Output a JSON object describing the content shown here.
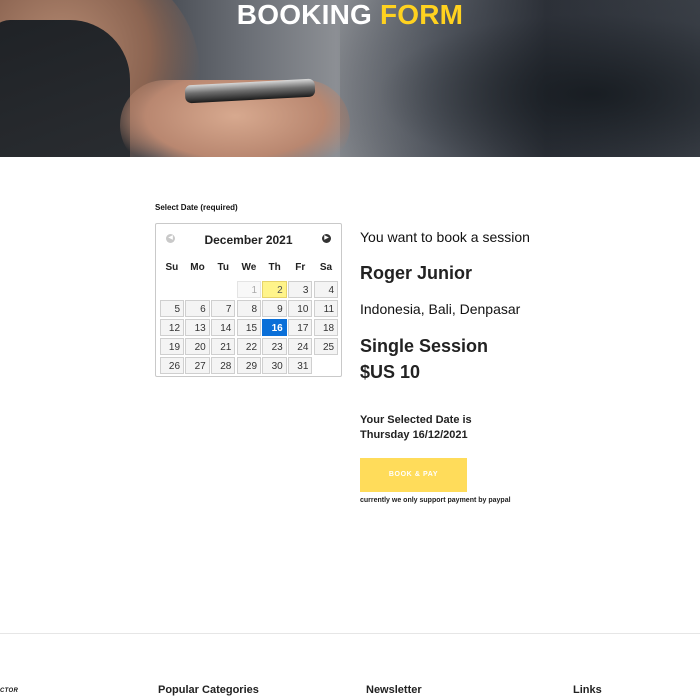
{
  "hero": {
    "title_part1": "BOOKING",
    "title_part2": "FORM",
    "accent_color": "#ffd21f"
  },
  "calendar": {
    "label": "Select Date (required)",
    "month_title": "December 2021",
    "prev_icon": "prev-arrow-icon",
    "next_icon": "next-arrow-icon",
    "weekdays": [
      "Su",
      "Mo",
      "Tu",
      "We",
      "Th",
      "Fr",
      "Sa"
    ],
    "weeks": [
      [
        "",
        "",
        "",
        "1",
        "2",
        "3",
        "4"
      ],
      [
        "5",
        "6",
        "7",
        "8",
        "9",
        "10",
        "11"
      ],
      [
        "12",
        "13",
        "14",
        "15",
        "16",
        "17",
        "18"
      ],
      [
        "19",
        "20",
        "21",
        "22",
        "23",
        "24",
        "25"
      ],
      [
        "26",
        "27",
        "28",
        "29",
        "30",
        "31",
        ""
      ]
    ],
    "disabled_day": "1",
    "today_day": "2",
    "selected_day": "16",
    "selected_color": "#0a6fd8",
    "today_color": "#fff48a"
  },
  "booking": {
    "intro": "You want to book a session",
    "name": "Roger Junior",
    "location": "Indonesia, Bali, Denpasar",
    "session": "Single Session",
    "price": "$US 10",
    "selected_label": "Your Selected Date is",
    "selected_date": "Thursday 16/12/2021",
    "button_label": "BOOK & PAY",
    "button_color": "#ffdc5a",
    "payment_note": "currently we only support payment by paypal"
  },
  "footer": {
    "logo_text": "CTOR",
    "columns": [
      "Popular Categories",
      "Newsletter",
      "Links"
    ]
  }
}
